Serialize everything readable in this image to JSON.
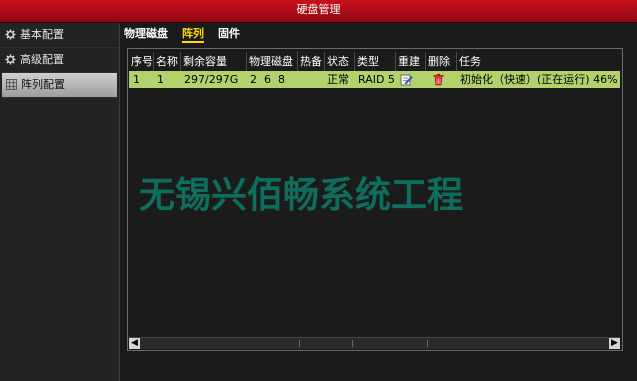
{
  "window": {
    "title": "硬盘管理"
  },
  "sidebar": {
    "items": [
      {
        "label": "基本配置",
        "icon": "gear-icon"
      },
      {
        "label": "高级配置",
        "icon": "gear-icon"
      },
      {
        "label": "阵列配置",
        "icon": "grid-icon",
        "active": true
      }
    ]
  },
  "tabs": [
    {
      "label": "物理磁盘"
    },
    {
      "label": "阵列",
      "active": true
    },
    {
      "label": "固件"
    }
  ],
  "table": {
    "headers": [
      "序号",
      "名称",
      "剩余容量",
      "物理磁盘",
      "热备",
      "状态",
      "类型",
      "重建",
      "删除",
      "任务"
    ],
    "rows": [
      {
        "index": "1",
        "name": "1",
        "free_capacity": "297/297G",
        "physical_disks": "2  6  8",
        "hot_spare": "",
        "status": "正常",
        "type": "RAID 5",
        "rebuild_icon": "edit-icon",
        "delete_icon": "trash-icon",
        "task": "初始化（快速）(正在运行) 46%"
      }
    ]
  },
  "watermark": "无锡兴佰畅系统工程",
  "colors": {
    "titlebar": "#c8101d",
    "row_highlight": "#b2d26d",
    "tab_active": "#ffd800",
    "watermark": "#0d6e5e"
  }
}
